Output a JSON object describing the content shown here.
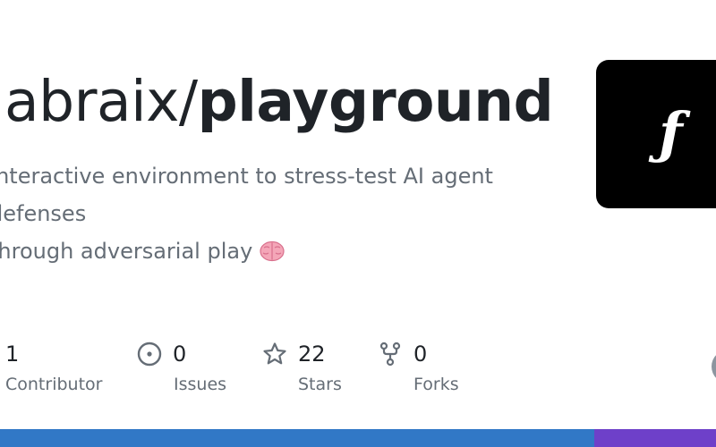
{
  "repo": {
    "owner": "labraix",
    "separator": "/",
    "name": "playground"
  },
  "description": {
    "line1": "Interactive environment to stress-test AI agent defenses",
    "line2": "through adversarial play"
  },
  "logo": {
    "glyph": "ƒ"
  },
  "stats": {
    "contributors": {
      "value": "1",
      "label": "Contributor"
    },
    "issues": {
      "value": "0",
      "label": "Issues"
    },
    "stars": {
      "value": "22",
      "label": "Stars"
    },
    "forks": {
      "value": "0",
      "label": "Forks"
    }
  },
  "icons": {
    "issues": "issue-opened-icon",
    "stars": "star-icon",
    "forks": "repo-forked-icon",
    "description_emoji": "brain-emoji"
  },
  "language_bar": {
    "segments": [
      {
        "color": "#3178c6",
        "share": 0.83
      },
      {
        "color": "#6e40c9",
        "share": 0.17
      }
    ]
  },
  "colors": {
    "text_primary": "#1f2328",
    "text_muted": "#656d76",
    "logo_background": "#000000"
  }
}
